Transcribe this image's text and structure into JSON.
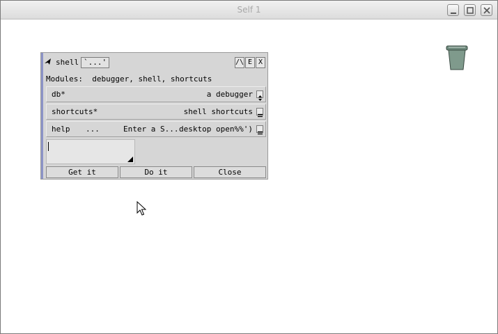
{
  "window": {
    "title": "Self 1"
  },
  "outliner": {
    "title": "shell",
    "more_label": "`...'",
    "header_buttons": [
      "/\\",
      "E",
      "X"
    ],
    "modules_label": "Modules:",
    "modules_value": "debugger, shell, shortcuts",
    "slots": [
      {
        "name": "db*",
        "value": "a debugger",
        "marker": "dropdown"
      },
      {
        "name": "shortcuts*",
        "value": "shell shortcuts",
        "marker": "equals"
      },
      {
        "name": "help",
        "mid1": "...",
        "mid2": "Enter a S...",
        "value": "desktop open%%')",
        "marker": "equals"
      }
    ],
    "buttons": {
      "get": "Get it",
      "do": "Do it",
      "close": "Close"
    }
  },
  "icons": {
    "trash": "trash-can-icon",
    "cursor": "mouse-pointer-icon",
    "window_controls": [
      "minimize-icon",
      "maximize-icon",
      "close-icon"
    ]
  },
  "colors": {
    "outliner_bar": "#8c94c8",
    "trash": "#7f9a8c"
  }
}
